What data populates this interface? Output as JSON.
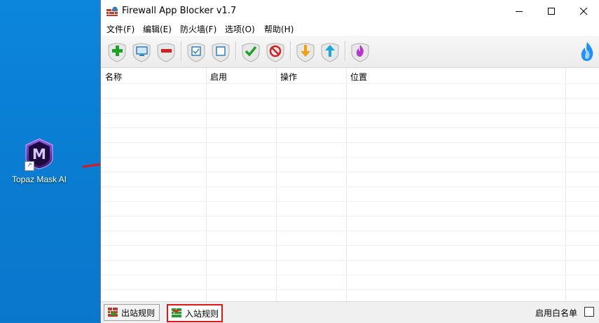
{
  "desktop": {
    "shortcut_label": "Topaz Mask AI",
    "logo_letter": "M"
  },
  "window": {
    "title": "Firewall App Blocker v1.7",
    "controls": [
      "minimize-icon",
      "maximize-icon",
      "close-icon"
    ]
  },
  "menu": {
    "items": [
      "文件(F)",
      "编辑(E)",
      "防火墙(F)",
      "选项(O)",
      "帮助(H)"
    ]
  },
  "toolbar": {
    "buttons": [
      {
        "name": "add-icon",
        "color": "#1fa22a"
      },
      {
        "name": "monitor-icon",
        "color": "#2f7fc1"
      },
      {
        "name": "remove-icon",
        "color": "#d42020"
      },
      {
        "name": "checkbox-checked-icon",
        "color": "#2f7fc1"
      },
      {
        "name": "checkbox-unchecked-icon",
        "color": "#2f7fc1"
      },
      {
        "name": "allow-check-icon",
        "color": "#1fa22a"
      },
      {
        "name": "block-icon",
        "color": "#d42020"
      },
      {
        "name": "arrow-down-icon",
        "color": "#f0a010"
      },
      {
        "name": "arrow-up-icon",
        "color": "#19a8d8"
      },
      {
        "name": "fire-icon",
        "color": "#b23ac8"
      }
    ],
    "brand_icon": "flame-logo-icon"
  },
  "table": {
    "columns": [
      "名称",
      "启用",
      "操作",
      "位置"
    ],
    "rows": []
  },
  "status": {
    "tabs": [
      {
        "label": "出站规则",
        "active": false
      },
      {
        "label": "入站规则",
        "active": true
      }
    ],
    "whitelist_label": "启用白名单",
    "whitelist_checked": false
  },
  "colors": {
    "desktop": "#0a7fd4",
    "highlight": "#e0161b",
    "annotation_arrow": "#e0161b"
  }
}
